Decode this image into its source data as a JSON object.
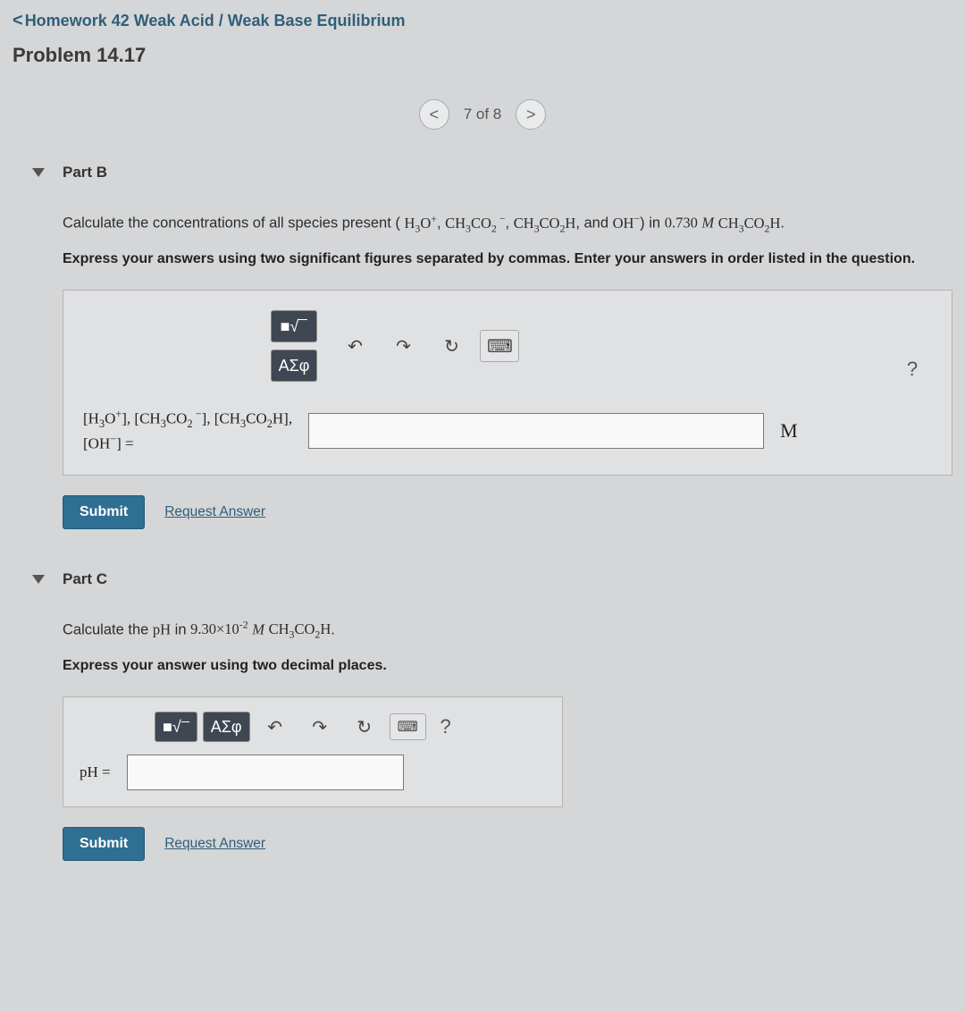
{
  "nav": {
    "back_label": "Homework 42 Weak Acid / Weak Base Equilibrium",
    "problem_title": "Problem 14.17",
    "pager_text": "7 of 8"
  },
  "partB": {
    "header": "Part B",
    "prompt_prefix": "Calculate the concentrations of all species present (",
    "species1": "H3O+",
    "species2": "CH3CO2−",
    "species3": "CH3CO2H",
    "species4": "OH−",
    "prompt_mid": ") in ",
    "concentration": "0.730",
    "conc_unit": "M",
    "solution_species": "CH3CO2H",
    "instructions": "Express your answers using two significant figures separated by commas. Enter your answers in order listed in the question.",
    "templates_label": "■√□",
    "greek_label": "ΑΣφ",
    "answer_lhs_eq": " =",
    "answer_value": "",
    "unit": "M",
    "submit": "Submit",
    "request": "Request Answer"
  },
  "partC": {
    "header": "Part C",
    "prompt_prefix": "Calculate the ",
    "pH_word": "pH",
    "prompt_mid": " in ",
    "concentration": "9.30×10",
    "conc_exp": "-2",
    "conc_unit": "M",
    "species": "CH3CO2H",
    "instructions": "Express your answer using two decimal places.",
    "templates_label": "■√□",
    "greek_label": "ΑΣφ",
    "answer_lhs": "pH",
    "answer_lhs_eq": " =",
    "answer_value": "",
    "submit": "Submit",
    "request": "Request Answer"
  },
  "icons": {
    "undo": "↶",
    "redo": "↷",
    "reset": "↻",
    "keyboard": "⌨",
    "help": "?"
  }
}
